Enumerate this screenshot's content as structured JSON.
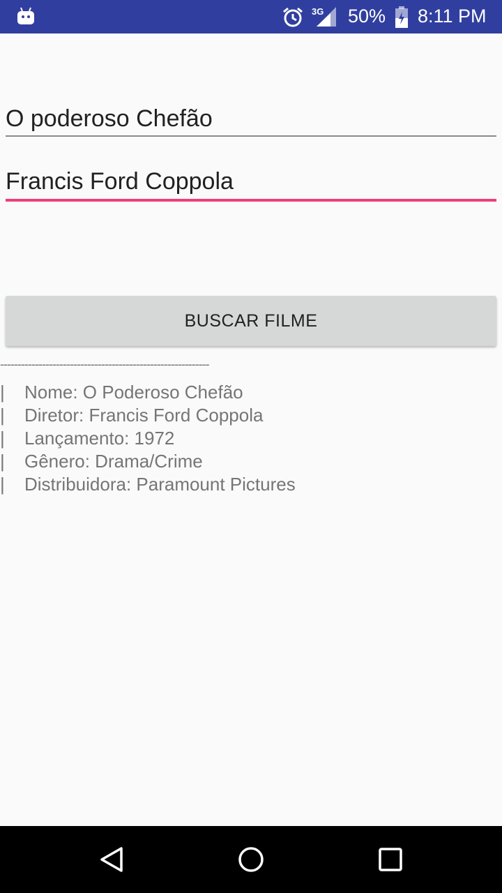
{
  "status_bar": {
    "network_type": "3G",
    "battery_percent": "50%",
    "time": "8:11 PM",
    "icons": [
      "android-icon",
      "alarm-icon",
      "signal-icon",
      "battery-icon"
    ],
    "background_color": "#303f9f"
  },
  "form": {
    "title_value": "O poderoso Chefão",
    "director_value": "Francis Ford Coppola",
    "accent_color": "#ec407a"
  },
  "actions": {
    "search_label": "BUSCAR FILME"
  },
  "result": {
    "divider": "------------------------------------------------------------",
    "bar_char": "|",
    "lines": [
      "Nome: O Poderoso Chefão",
      "Diretor: Francis Ford Coppola",
      "Lançamento: 1972",
      "Gênero: Drama/Crime",
      "Distribuidora: Paramount Pictures"
    ]
  },
  "nav_bar": {
    "buttons": [
      "back-icon",
      "home-icon",
      "recents-icon"
    ]
  }
}
